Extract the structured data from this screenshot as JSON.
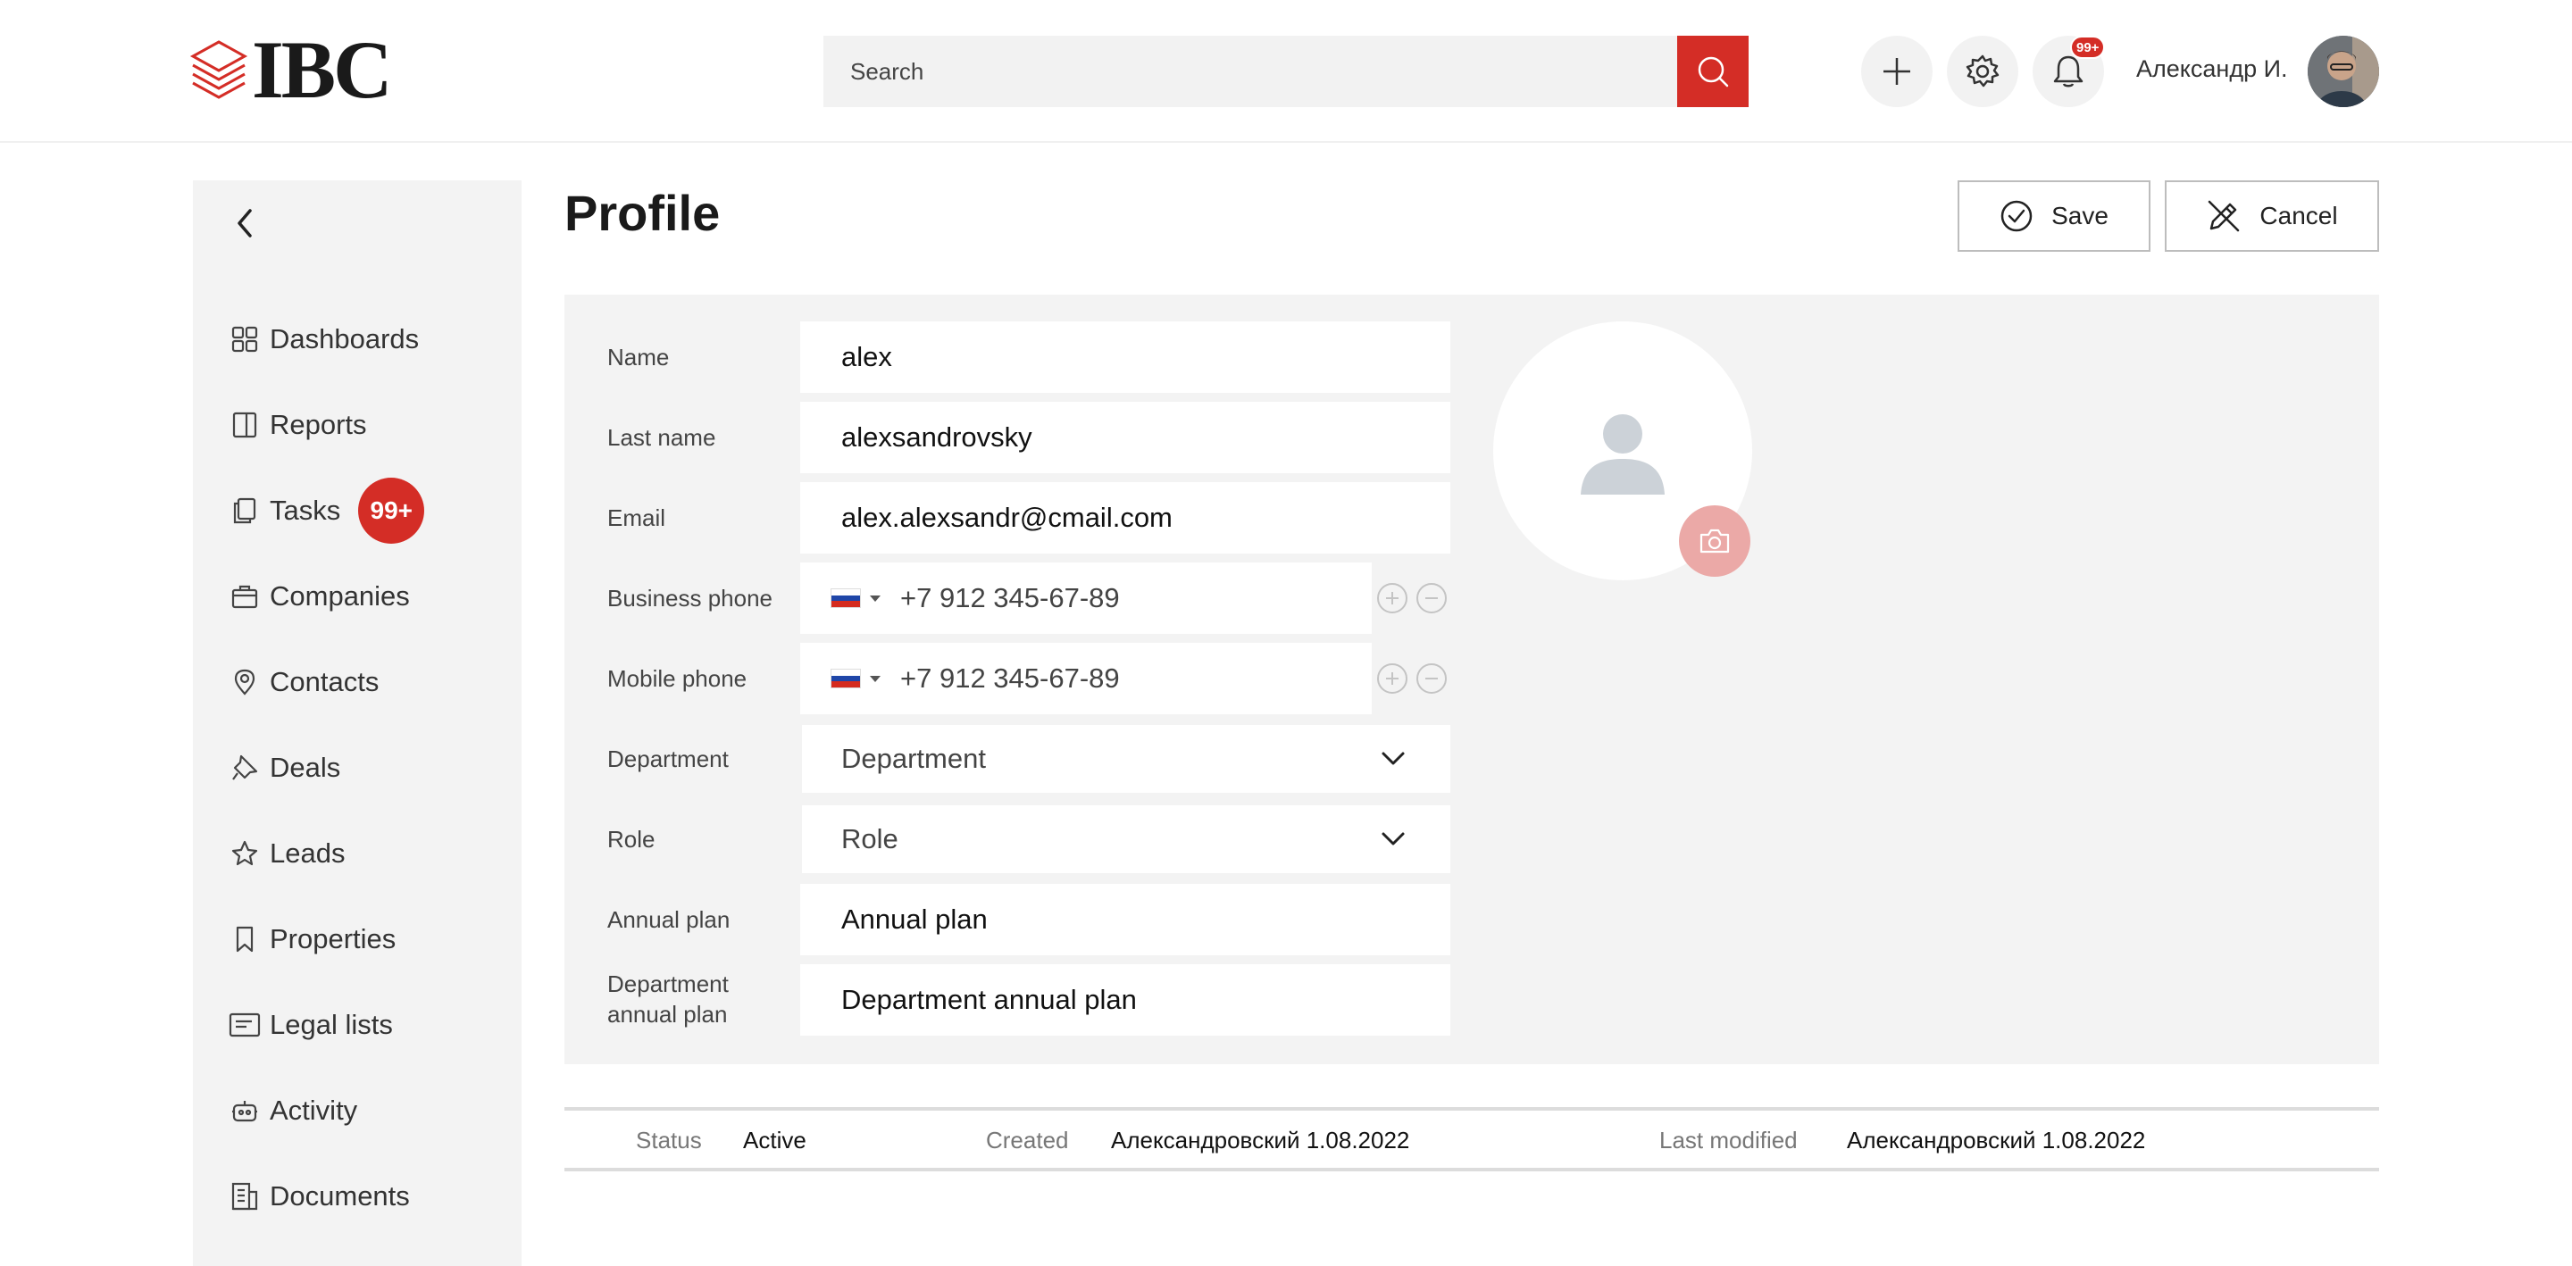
{
  "header": {
    "logo_text": "IBC",
    "search_placeholder": "Search",
    "notifications_badge": "99+",
    "user_name": "Александр И."
  },
  "sidebar": {
    "items": [
      {
        "label": "Dashboards",
        "icon": "dashboard-icon"
      },
      {
        "label": "Reports",
        "icon": "reports-icon"
      },
      {
        "label": "Tasks",
        "icon": "tasks-icon",
        "badge": "99+"
      },
      {
        "label": "Companies",
        "icon": "companies-icon"
      },
      {
        "label": "Contacts",
        "icon": "location-pin-icon"
      },
      {
        "label": "Deals",
        "icon": "pin-icon"
      },
      {
        "label": "Leads",
        "icon": "star-icon"
      },
      {
        "label": "Properties",
        "icon": "bookmark-icon"
      },
      {
        "label": "Legal lists",
        "icon": "list-card-icon"
      },
      {
        "label": "Activity",
        "icon": "robot-icon"
      },
      {
        "label": "Documents",
        "icon": "documents-icon"
      }
    ]
  },
  "page": {
    "title": "Profile",
    "save_label": "Save",
    "cancel_label": "Cancel"
  },
  "form": {
    "name": {
      "label": "Name",
      "value": "alex"
    },
    "last_name": {
      "label": "Last name",
      "value": "alexsandrovsky"
    },
    "email": {
      "label": "Email",
      "value": "alex.alexsandr@cmail.com"
    },
    "business_phone": {
      "label": "Business phone",
      "value": "+7 912 345-67-89",
      "country": "RU"
    },
    "mobile_phone": {
      "label": "Mobile phone",
      "value": "+7 912 345-67-89",
      "country": "RU"
    },
    "department": {
      "label": "Department",
      "value": "Department"
    },
    "role": {
      "label": "Role",
      "value": "Role"
    },
    "annual_plan": {
      "label": "Annual plan",
      "placeholder": "Annual plan"
    },
    "department_annual_plan": {
      "label_line1": "Department",
      "label_line2": "annual plan",
      "placeholder": "Department annual plan"
    }
  },
  "status_bar": {
    "status_label": "Status",
    "status_value": "Active",
    "created_label": "Created",
    "created_value": "Александровский 1.08.2022",
    "modified_label": "Last modified",
    "modified_value": "Александровский 1.08.2022"
  },
  "colors": {
    "accent": "#d42d26",
    "panel_bg": "#f3f3f3"
  }
}
